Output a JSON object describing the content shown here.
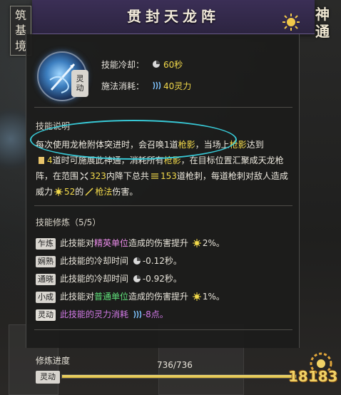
{
  "realm": {
    "chars": [
      "筑",
      "基",
      "境"
    ]
  },
  "header": {
    "title": "贯封天龙阵"
  },
  "logo": {
    "chars": [
      "神",
      "通"
    ]
  },
  "skill": {
    "tag": [
      "灵",
      "动"
    ],
    "cooldown_label": "技能冷却：",
    "cooldown_value": "60秒",
    "cost_label": "施法消耗：",
    "cost_value": "40灵力"
  },
  "description": {
    "title": "技能说明",
    "segments": {
      "s1": "每次使用龙枪附体突进时，会召唤1道",
      "s2": "枪影",
      "s3": "，当场上",
      "s4": "枪影",
      "s5": "达到",
      "s6": "4",
      "s7": "道时可施展此神通，消耗所有",
      "s8": "枪影",
      "s9": "，在目标位置汇聚成天龙枪阵，在范围",
      "s10": "323",
      "s11": "内降下总共",
      "s12": "153",
      "s13": "道枪刺，每道枪刺对敌人造成威力",
      "s14": "52",
      "s15": "的",
      "s16": "枪法",
      "s17": "伤害。"
    }
  },
  "cultivation": {
    "title": "技能修炼（5/5）",
    "rows": [
      {
        "tag": "乍炼",
        "pre": "此技能对",
        "hl": "精英单位",
        "post": "造成的伤害提升",
        "value": "2%。"
      },
      {
        "tag": "娴熟",
        "pre": "此技能的冷却时间",
        "hl": "",
        "post": "",
        "value": "-0.12秒。"
      },
      {
        "tag": "通晓",
        "pre": "此技能的冷却时间",
        "hl": "",
        "post": "",
        "value": "-0.92秒。"
      },
      {
        "tag": "小成",
        "pre": "此技能对",
        "hl": "普通单位",
        "post": "造成的伤害提升",
        "value": "1%。"
      },
      {
        "tag": "灵动",
        "pre": "此技能的灵力消耗",
        "hl": "",
        "post": "",
        "value": "-8点。"
      }
    ]
  },
  "progress": {
    "label": "修炼进度",
    "tag": "灵动",
    "text": "736/736",
    "fraction": 1.0
  },
  "watermark": {
    "text": "18183"
  },
  "colors": {
    "header": "#3b2f56",
    "highlight": "#f2d94a",
    "pink": "#e98be8",
    "green": "#5fe07a",
    "annotation": "#38c9d6"
  }
}
